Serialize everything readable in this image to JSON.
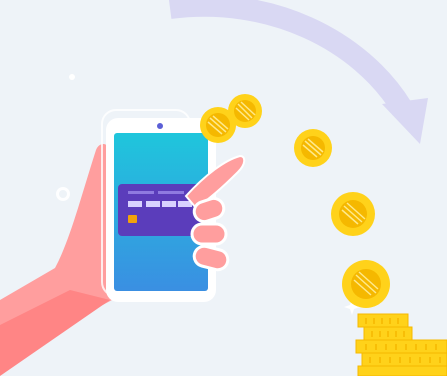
{
  "illustration": {
    "subject": "hand-holding-phone-with-card-and-falling-coins",
    "colors": {
      "background": "#eef3f8",
      "arrow": "#d9d8f3",
      "skin": "#ff9e9e",
      "skin_shadow": "#ff8585",
      "skin_outline": "#ffffff",
      "phone_body": "#ffffff",
      "screen_top": "#1fc6dc",
      "screen_bottom": "#3a8fe2",
      "card": "#5b3dbb",
      "card_chip": "#f2a20b",
      "card_text": "#d8d2ff",
      "coin": "#ffd21a",
      "coin_dark": "#f5b800",
      "coin_light": "#ffe98a",
      "sparkle": "#ffffff"
    },
    "coin_count": 6,
    "stack_layers": 5
  }
}
